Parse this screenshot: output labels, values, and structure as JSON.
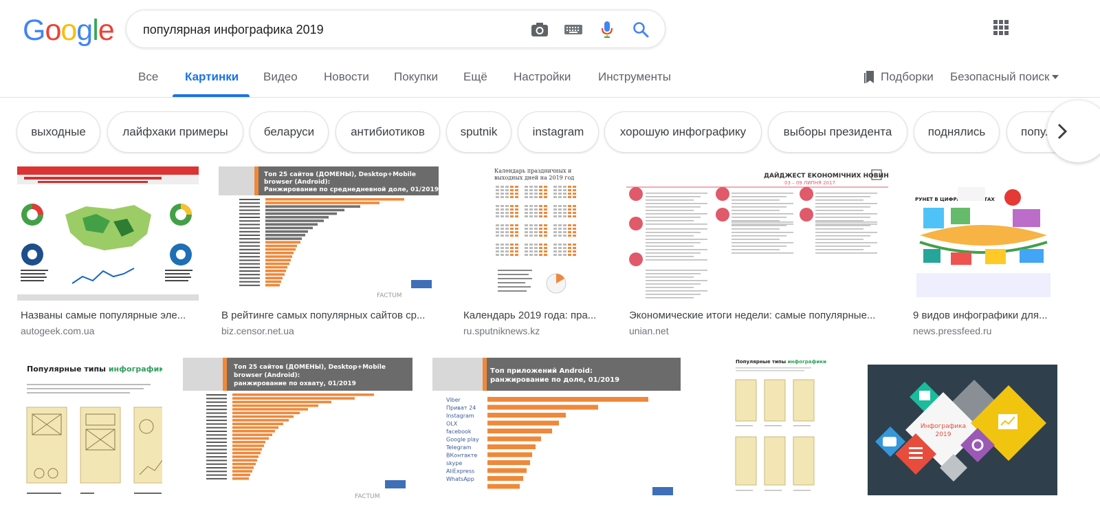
{
  "logo": "Google",
  "search": {
    "query": "популярная инфографика 2019"
  },
  "icons": {
    "camera": "camera-icon",
    "keyboard": "keyboard-icon",
    "mic": "mic-icon",
    "search": "search-icon",
    "apps": "apps-grid-icon"
  },
  "tabs": [
    "Все",
    "Картинки",
    "Видео",
    "Новости",
    "Покупки",
    "Ещё",
    "Настройки",
    "Инструменты"
  ],
  "active_tab": "Картинки",
  "right_tools": {
    "collections": "Подборки",
    "safe_search": "Безопасный поиск"
  },
  "chips": [
    "выходные",
    "лайфхаки примеры",
    "беларуси",
    "антибиотиков",
    "sputnik",
    "instagram",
    "хорошую инфографику",
    "выборы президента",
    "поднялись",
    "попу..."
  ],
  "colors": {
    "accent": "#1a73e8",
    "orange": "#f0883a",
    "gray_header": "#6b6b6b"
  },
  "results_row1": [
    {
      "caption": "Названы самые популярные эле...",
      "source": "autogeek.com.ua"
    },
    {
      "caption": "В рейтинге самых популярных сайтов ср...",
      "source": "biz.censor.net.ua"
    },
    {
      "caption": "Календарь 2019 года: пра...",
      "source": "ru.sputniknews.kz"
    },
    {
      "caption": "Экономические итоги недели: самые популярные...",
      "source": "unian.net"
    },
    {
      "caption": "9 видов инфографики для...",
      "source": "news.pressfeed.ru"
    }
  ],
  "thumb_text": {
    "t2_title": "Топ 25 сайтов (ДОМЕНЫ), Desktop+Mobile browser (Android): Ранжирование по среднедневной доле, 01/2019",
    "t3_title": "Календарь праздничных и выходных дней на 2019 год",
    "t4_title": "ДАЙДЖЕСТ ЕКОНОМІЧНИХ НОВИН",
    "t4_sub": "03 – 09 ЛИПНЯ 2017",
    "t5_title": "РУНЕТ В ЦИФРАХ И ФАКТАХ",
    "t6_title_a": "Популярные типы ",
    "t6_title_b": "инфографики",
    "t7_title": "Топ 25 сайтов (ДОМЕНЫ), Desktop+Mobile browser (Android): ранжирование по охвату, 01/2019",
    "t8_title": "Топ приложений Android: ранжирование по доле, 01/2019",
    "t9_title_a": "Популярные типы ",
    "t9_title_b": "инфографики",
    "t10_title": "Инфографика 2019",
    "factum": "FACTUM",
    "t8_apps": [
      "Viber",
      "Приват 24",
      "Instagram",
      "OLX",
      "facebook",
      "Google play",
      "Telegram",
      "ВКонтакте",
      "skype",
      "AliExpress",
      "WhatsApp"
    ]
  },
  "bar_widths": {
    "t2": [
      0.88,
      0.72,
      0.6,
      0.5,
      0.45,
      0.4,
      0.37,
      0.33,
      0.3,
      0.27,
      0.25,
      0.23,
      0.22,
      0.2,
      0.19,
      0.18,
      0.17,
      0.16,
      0.15,
      0.14,
      0.13,
      0.12,
      0.11,
      0.1,
      0.09
    ],
    "t7": [
      0.86,
      0.74,
      0.6,
      0.52,
      0.46,
      0.41,
      0.37,
      0.34,
      0.31,
      0.28,
      0.26,
      0.24,
      0.22,
      0.2,
      0.19,
      0.18,
      0.17,
      0.16,
      0.15,
      0.14,
      0.13,
      0.12,
      0.11,
      0.1
    ],
    "t8": [
      0.9,
      0.62,
      0.44,
      0.4,
      0.36,
      0.3,
      0.27,
      0.25,
      0.24,
      0.22,
      0.2,
      0.18
    ]
  }
}
